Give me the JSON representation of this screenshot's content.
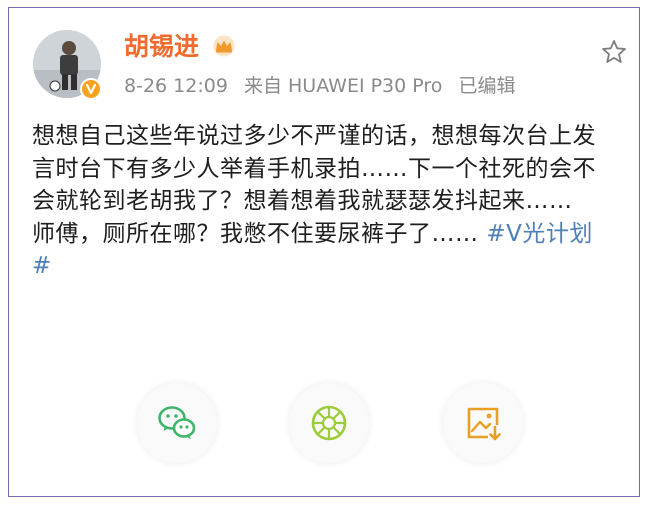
{
  "post": {
    "author": "胡锡进",
    "date": "8-26 12:09",
    "source": "来自 HUAWEI P30 Pro",
    "edited": "已编辑",
    "paragraph1": "想想自己这些年说过多少不严谨的话，想想每次台上发言时台下有多少人举着手机录拍……下一个社死的会不会就轮到老胡我了？想着想着我就瑟瑟发抖起来……",
    "paragraph2": "师傅，厕所在哪？我憋不住要尿裤子了…… ",
    "hashtag": "#V光计划#"
  },
  "icons": {
    "author_badge": "crown-icon",
    "verified": "verified-v-icon",
    "favorite": "star-icon",
    "share_wechat": "wechat-icon",
    "share_moments": "moments-icon",
    "save_image": "save-image-icon"
  },
  "colors": {
    "name": "#f16a2f",
    "hashtag": "#4f7fb8",
    "meta": "#8a8a8a",
    "wechat": "#3db56b",
    "moments": "#9ccc3b",
    "save": "#e8a024"
  }
}
